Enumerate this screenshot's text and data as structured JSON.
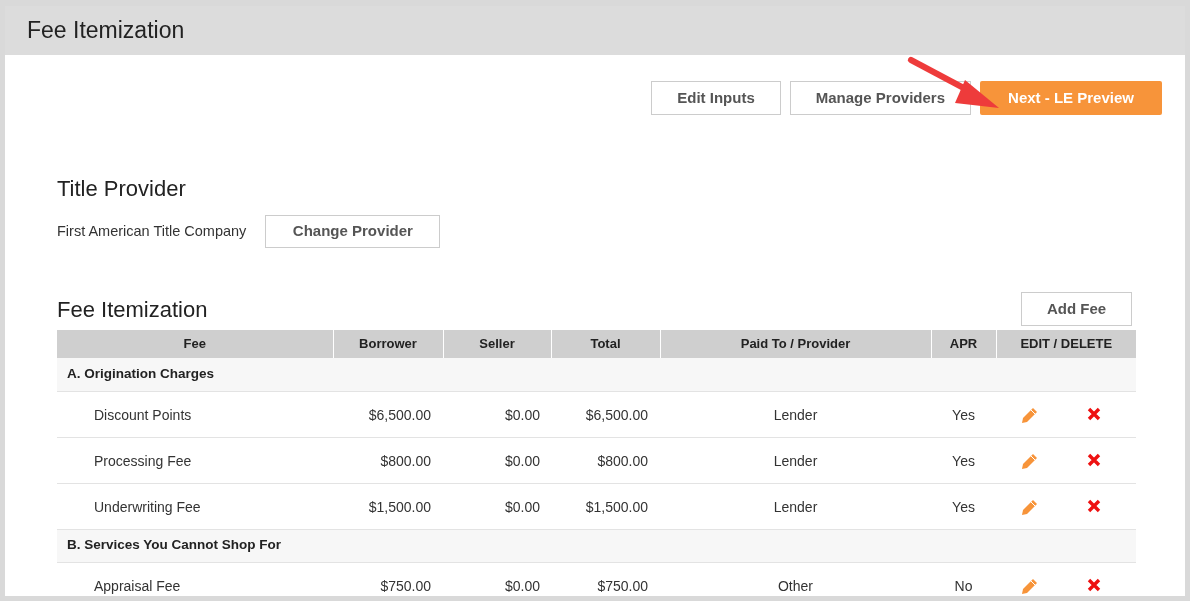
{
  "header": {
    "title": "Fee Itemization"
  },
  "actions": [
    {
      "label": "Edit Inputs",
      "primary": false
    },
    {
      "label": "Manage Providers",
      "primary": false
    },
    {
      "label": "Next - LE Preview",
      "primary": true
    }
  ],
  "title_provider": {
    "heading": "Title Provider",
    "name": "First American Title Company",
    "button": "Change Provider"
  },
  "fees": {
    "heading": "Fee Itemization",
    "add_button": "Add Fee",
    "columns": [
      "Fee",
      "Borrower",
      "Seller",
      "Total",
      "Paid To / Provider",
      "APR",
      "EDIT / DELETE"
    ],
    "rows": [
      {
        "kind": "section",
        "label": "A. Origination Charges"
      },
      {
        "kind": "fee",
        "fee": "Discount Points",
        "borrower": "$6,500.00",
        "seller": "$0.00",
        "total": "$6,500.00",
        "paid_to": "Lender",
        "apr": "Yes"
      },
      {
        "kind": "fee",
        "fee": "Processing Fee",
        "borrower": "$800.00",
        "seller": "$0.00",
        "total": "$800.00",
        "paid_to": "Lender",
        "apr": "Yes"
      },
      {
        "kind": "fee",
        "fee": "Underwriting Fee",
        "borrower": "$1,500.00",
        "seller": "$0.00",
        "total": "$1,500.00",
        "paid_to": "Lender",
        "apr": "Yes"
      },
      {
        "kind": "section",
        "label": "B. Services You Cannot Shop For"
      },
      {
        "kind": "fee",
        "fee": "Appraisal Fee",
        "borrower": "$750.00",
        "seller": "$0.00",
        "total": "$750.00",
        "paid_to": "Other",
        "apr": "No"
      }
    ]
  }
}
